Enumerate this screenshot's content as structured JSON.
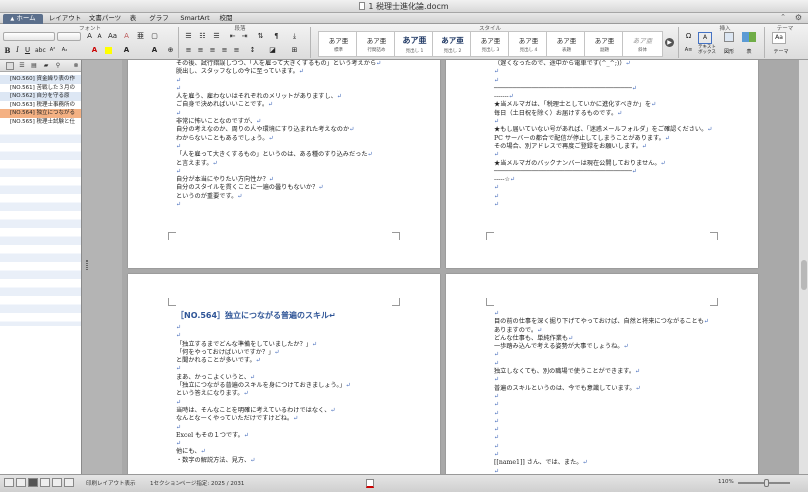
{
  "window": {
    "title": "1 税理士進化論.docm"
  },
  "tabs": [
    "ホーム",
    "レイアウト",
    "文書パーツ",
    "表",
    "グラフ",
    "SmartArt",
    "校閲"
  ],
  "ribbon": {
    "groups": {
      "font": "フォント",
      "paragraph": "段落",
      "styles": "スタイル",
      "insert": "挿入",
      "theme": "テーマ"
    },
    "font_name": "",
    "font_size": "",
    "styles": [
      {
        "sample": "あア亜",
        "name": "標準"
      },
      {
        "sample": "あア亜",
        "name": "行間詰め"
      },
      {
        "sample": "あア亜",
        "name": "見出し 1"
      },
      {
        "sample": "あア亜",
        "name": "見出し 2"
      },
      {
        "sample": "あア亜",
        "name": "見出し 3"
      },
      {
        "sample": "あア亜",
        "name": "見出し 4"
      },
      {
        "sample": "あア亜",
        "name": "表題"
      },
      {
        "sample": "あア亜",
        "name": "副題"
      },
      {
        "sample": "あア亜",
        "name": "斜体"
      }
    ],
    "insert_text_box": "テキスト\nボックス",
    "insert_shape": "図形",
    "insert_table": "表",
    "theme": "テーマ"
  },
  "sidebar": {
    "items": [
      {
        "label": "[NO.560] 資金繰り表の作"
      },
      {
        "label": "[NO.561] 苦戦した３月の"
      },
      {
        "label": "[NO.562] 自分を守る原"
      },
      {
        "label": "[NO.563] 税理士事務所の"
      },
      {
        "label": "[NO.564] 独立につながる"
      },
      {
        "label": "[NO.565] 税理士試験と仕"
      }
    ],
    "selected_index": 4
  },
  "pages": {
    "top_left": [
      "その後、試行錯誤しつつ、「人を雇って大きくするもの」という考えから↵",
      "脱出し、スタッフなしの今に至っています。↵",
      "↵",
      "↵",
      "人を雇う、雇わないはそれぞれのメリットがありますし、↵",
      "ご自身で決めればいいことです。↵",
      "↵",
      "非常に怖いことなのですが、↵",
      "自分の考えなのか、周りの人や環境にすり込まれた考えなのか↵",
      "わからないこともあるでしょう。↵",
      "↵",
      "「人を雇って大きくするもの」というのは、ある種のすり込みだった↵",
      "と言えます。↵",
      "↵",
      "自分が本当にやりたい方向性か？↵",
      "自分のスタイルを貫くことに一遍の曇りもないか？↵",
      "というのが重要です。↵",
      "↵"
    ],
    "top_right": [
      "（遅くなったので、途中から電車です(^_^;)）↵",
      "↵",
      "↵",
      "─────────────────────────────────────↵",
      "-------↵",
      "★当メルマガは、「税理士としていかに進化すべきか」を↵",
      "毎日（土日祝を除く）お届けするものです。↵",
      "↵",
      "★もし届いていない号があれば、「迷惑メールフォルダ」をご確認ください。↵",
      "PC サーバーの都合で配信が停止してしまうことがあります。↵",
      "その場合、別アドレスで再度ご登録をお願いします。↵",
      "↵",
      "★当メルマガのバックナンバーは現在公開しておりません。↵",
      "─────────────────────────────────────↵",
      "-----☆↵",
      "↵",
      "↵",
      "↵"
    ],
    "bottom_left_heading": "［NO.564］独立につながる普遍のスキル↵",
    "bottom_left": [
      "↵",
      "↵",
      "「独立するまでどんな準備をしていましたか？」↵",
      "「何をやっておけばいいですか？」↵",
      "と聞かれることが多いです。↵",
      "↵",
      "まあ、かっこよくいうと、↵",
      "「独立につながる普遍のスキルを身につけておきましょう。」↵",
      "という答えになります。↵",
      "↵",
      "当時は、そんなことを明確に考えているわけではなく、↵",
      "なんとなーくやっていただけですけどね。↵",
      "↵",
      "Excel もその１つです。↵",
      "↵",
      "他にも、↵",
      "・数字の解説方法、見方、↵"
    ],
    "bottom_right": [
      "↵",
      "目の前の仕事を深く掘り下げてやっておけば、自然と将来につながることも↵",
      "ありますので。↵",
      "どんな仕事も、単純作業も↵",
      "一歩踏み込んで考える姿勢が大事でしょうね。↵",
      "↵",
      "↵",
      "独立しなくても、別の職場で使うことができます。↵",
      "↵",
      "普遍のスキルというのは、今でも意識しています。↵",
      "↵",
      "↵",
      "↵",
      "↵",
      "↵",
      "↵",
      "↵",
      "↵",
      "[[name1]] さん、では、また。↵",
      "↵"
    ]
  },
  "status": {
    "view": "印刷レイアウト表示",
    "section": "1セクション",
    "page": "ページ指定: 2025 / 2031",
    "zoom": "110%"
  }
}
